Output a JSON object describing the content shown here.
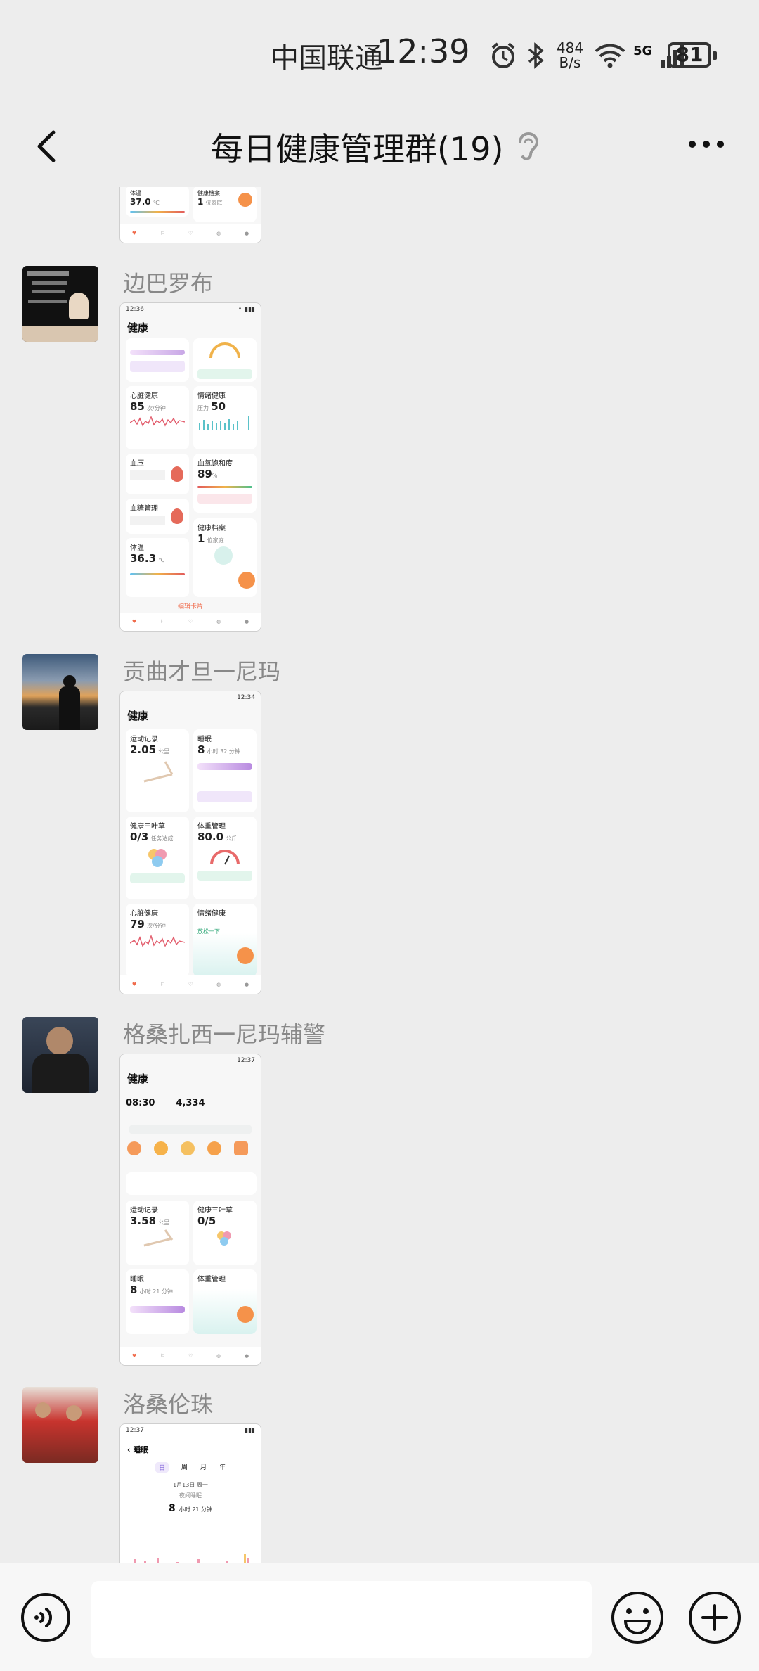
{
  "status_bar": {
    "carrier": "中国联通",
    "time": "12:39",
    "net_speed_value": "484",
    "net_speed_unit": "B/s",
    "network": "5G",
    "battery": "81"
  },
  "header": {
    "title": "每日健康管理群(19)"
  },
  "messages": [
    {
      "sender": "边巴罗布",
      "shot": {
        "time": "12:36",
        "title": "健康",
        "cards": [
          {
            "title": "心脏健康",
            "value": "85",
            "unit": "次/分钟"
          },
          {
            "title": "情绪健康",
            "value": "50",
            "unit": "压力"
          },
          {
            "title": "血压",
            "value": "",
            "unit": ""
          },
          {
            "title": "血氧饱和度",
            "value": "89",
            "unit": "%"
          },
          {
            "title": "血糖管理",
            "value": "",
            "unit": ""
          },
          {
            "title": "",
            "value": "",
            "unit": ""
          },
          {
            "title": "体温",
            "value": "36.3",
            "unit": "℃"
          },
          {
            "title": "健康档案",
            "value": "1",
            "unit": "位家庭"
          }
        ],
        "footer": "编辑卡片"
      }
    },
    {
      "sender": "贡曲才旦一尼玛",
      "shot": {
        "time": "12:34",
        "title": "健康",
        "cards": [
          {
            "title": "运动记录",
            "value": "2.05",
            "unit": "公里"
          },
          {
            "title": "睡眠",
            "value": "8",
            "unit": "小时 32 分钟"
          },
          {
            "title": "健康三叶草",
            "value": "0/3",
            "unit": "任务达成"
          },
          {
            "title": "体重管理",
            "value": "80.0",
            "unit": "公斤"
          },
          {
            "title": "心脏健康",
            "value": "79",
            "unit": "次/分钟"
          },
          {
            "title": "情绪健康",
            "value": "",
            "unit": "放松一下"
          }
        ]
      }
    },
    {
      "sender": "格桑扎西一尼玛辅警",
      "shot": {
        "time": "12:37",
        "title": "健康",
        "top_stats": [
          "08:30",
          "4,334"
        ],
        "cards": [
          {
            "title": "运动记录",
            "value": "3.58",
            "unit": "公里"
          },
          {
            "title": "健康三叶草",
            "value": "0/5",
            "unit": ""
          },
          {
            "title": "睡眠",
            "value": "8",
            "unit": "小时 21 分钟"
          },
          {
            "title": "体重管理",
            "value": "",
            "unit": ""
          }
        ]
      }
    },
    {
      "sender": "洛桑伦珠",
      "shot": {
        "time": "12:37",
        "title": "睡眠",
        "tabs": [
          "日",
          "周",
          "月",
          "年"
        ],
        "date": "1月13日 周一",
        "label": "夜间睡眠",
        "value": "8",
        "unit": "小时 21 分钟"
      }
    }
  ],
  "top_shot_partial": {
    "cards": [
      {
        "title": "体温",
        "value": "37.0",
        "unit": "℃"
      },
      {
        "title": "健康档案",
        "value": "1",
        "unit": "位家庭"
      }
    ]
  },
  "input_bar": {
    "placeholder": ""
  }
}
